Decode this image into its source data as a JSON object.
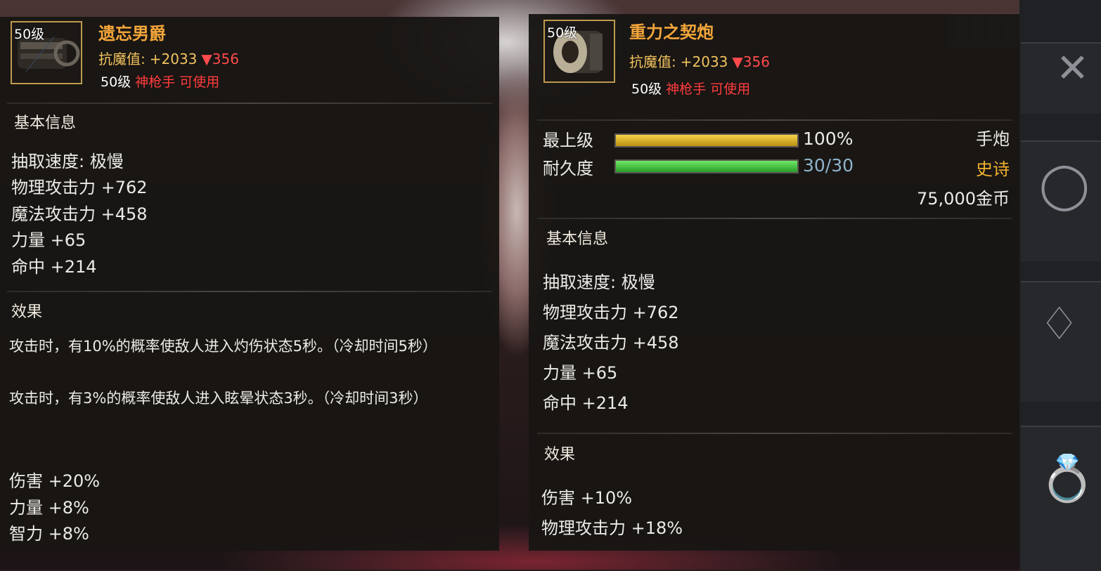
{
  "left_item": {
    "level_badge": "50级",
    "name": "遗忘男爵",
    "icon": "hand-cannon-icon",
    "magic_resist_label": "抗魔值:",
    "magic_resist_bonus": "+2033",
    "magic_resist_drop": "▼356",
    "req_level": "50级",
    "req_class": "神枪手 可使用",
    "basic_title": "基本信息",
    "stats": [
      "抽取速度: 极慢",
      "物理攻击力 +762",
      "魔法攻击力 +458",
      "力量 +65",
      "命中 +214"
    ],
    "effect_title": "效果",
    "effects": [
      "攻击时，有10%的概率使敌人进入灼伤状态5秒。（冷却时间5秒）",
      "攻击时，有3%的概率使敌人进入眩晕状态3秒。（冷却时间3秒）"
    ],
    "bonuses": [
      "伤害 +20%",
      "力量 +8%",
      "智力 +8%"
    ]
  },
  "right_item": {
    "level_badge": "50级",
    "name": "重力之契炮",
    "icon": "cannon-barrel-icon",
    "magic_resist_label": "抗魔值:",
    "magic_resist_bonus": "+2033",
    "magic_resist_drop": "▼356",
    "req_level": "50级",
    "req_class": "神枪手 可使用",
    "grade_label": "最上级",
    "grade_value": "100%",
    "grade_fraction": 1.0,
    "durability_label": "耐久度",
    "durability_value": "30/30",
    "durability_fraction": 1.0,
    "weapon_type": "手炮",
    "rarity": "史诗",
    "price": "75,000金币",
    "basic_title": "基本信息",
    "stats": [
      "抽取速度: 极慢",
      "物理攻击力 +762",
      "魔法攻击力 +458",
      "力量 +65",
      "命中 +214"
    ],
    "effect_title": "效果",
    "bonuses": [
      "伤害 +10%",
      "物理攻击力 +18%"
    ]
  },
  "colors": {
    "name": "#f4a63a",
    "class_red": "#ff3c3c",
    "rarity_gold": "#f2b22e",
    "grade_bar": "#e3b521",
    "durability_bar": "#3fc23a",
    "durability_text": "#8fb4cc"
  },
  "sidebar_icons": [
    "close-icon",
    "bracelet-icon",
    "necklace-icon",
    "ring-icon"
  ]
}
